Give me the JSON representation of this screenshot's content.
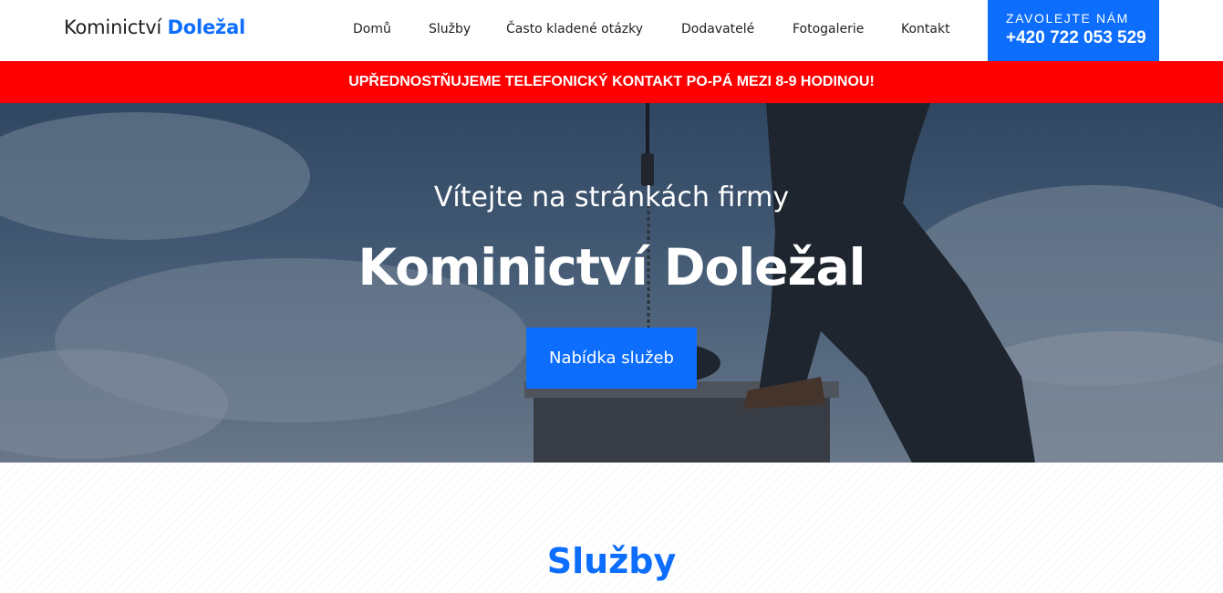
{
  "header": {
    "logo_main": "Kominictví",
    "logo_accent": "Doležal",
    "nav": [
      "Domů",
      "Služby",
      "Často kladené otázky",
      "Dodavatelé",
      "Fotogalerie",
      "Kontakt"
    ],
    "call": {
      "label": "ZAVOLEJTE NÁM",
      "phone": "+420 722 053 529"
    }
  },
  "notice": {
    "text": "UPŘEDNOSTŇUJEME TELEFONICKÝ KONTAKT PO-PÁ MEZI 8-9 HODINOU!"
  },
  "hero": {
    "subtitle": "Vítejte na stránkách firmy",
    "title": "Kominictví Doležal",
    "button": "Nabídka služeb"
  },
  "services": {
    "title": "Služby"
  },
  "colors": {
    "accent": "#0d6efd",
    "notice_bg": "#ff0000",
    "text_dark": "#222222"
  }
}
